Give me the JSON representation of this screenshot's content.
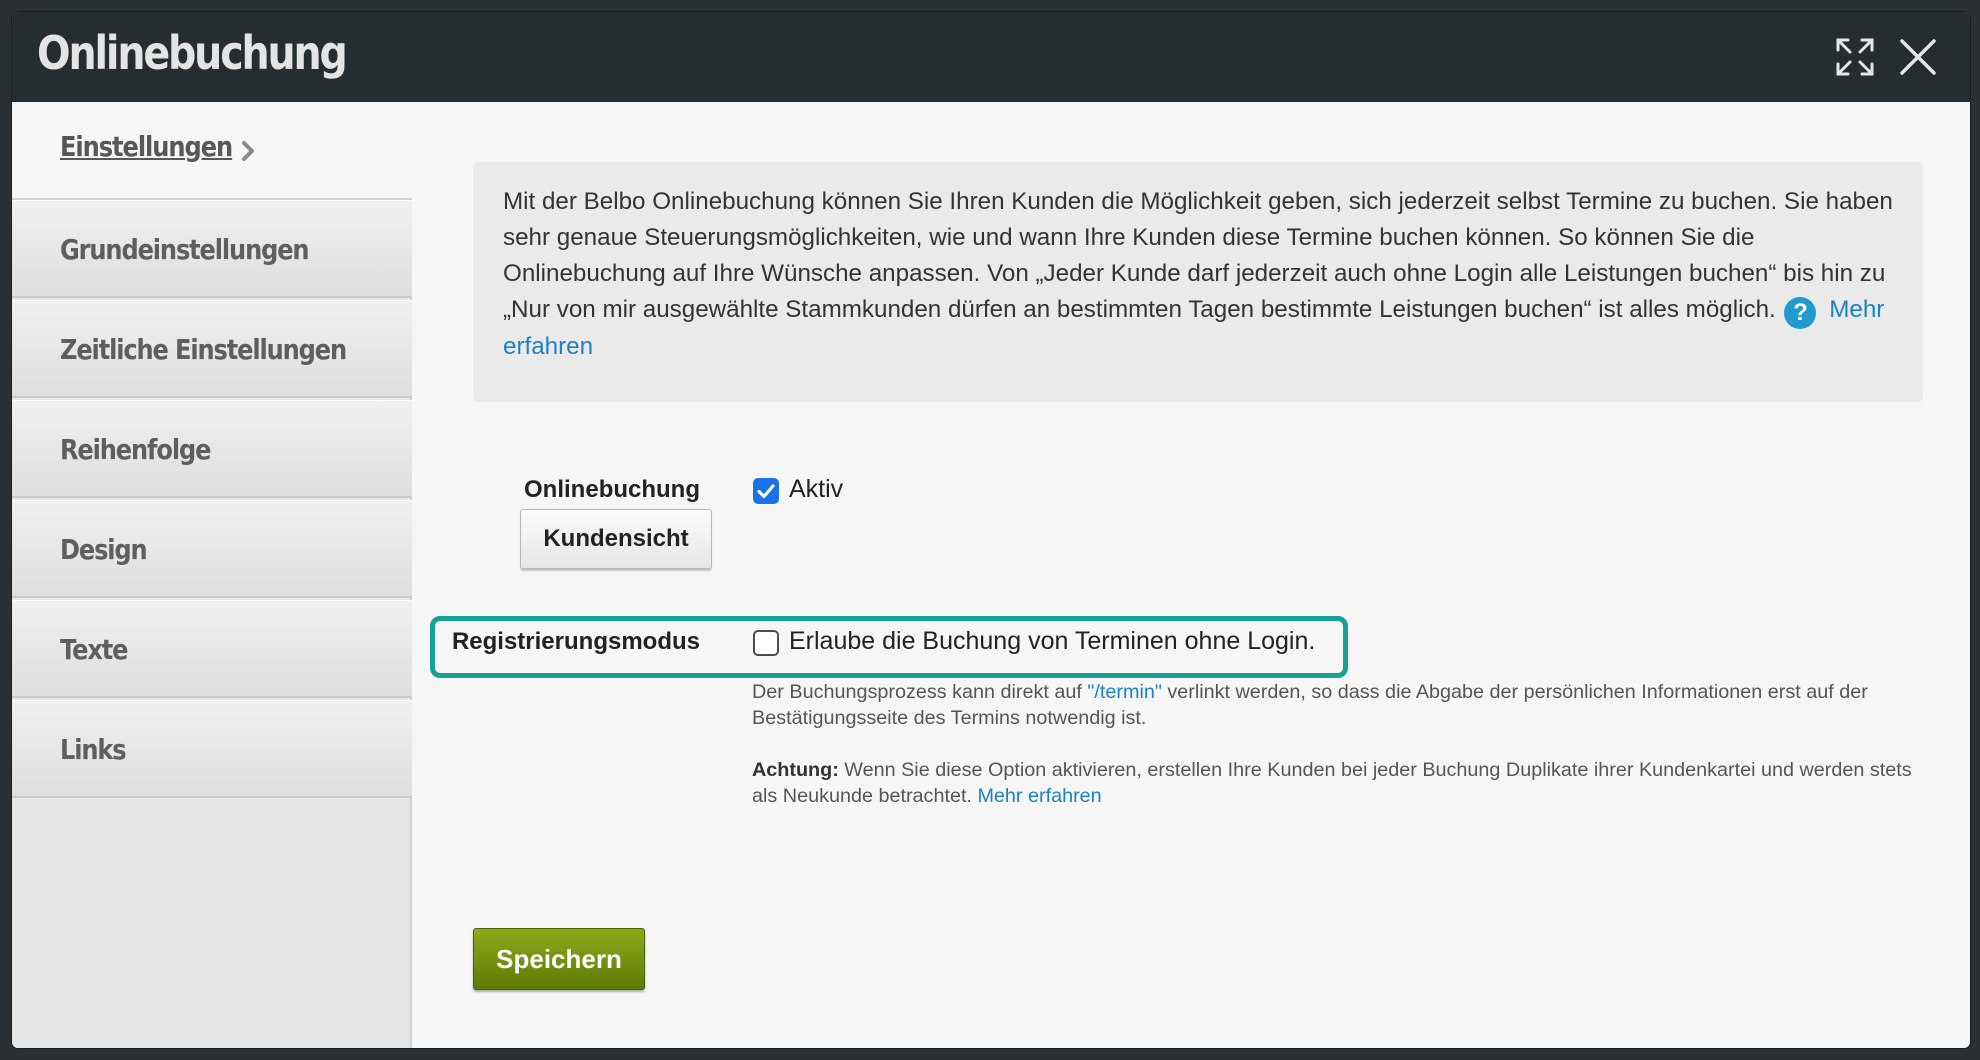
{
  "window": {
    "title": "Onlinebuchung"
  },
  "sidebar": {
    "active": {
      "label": "Einstellungen"
    },
    "items": [
      {
        "label": "Grundeinstellungen"
      },
      {
        "label": "Zeitliche Einstellungen"
      },
      {
        "label": "Reihenfolge"
      },
      {
        "label": "Design"
      },
      {
        "label": "Texte"
      },
      {
        "label": "Links"
      }
    ]
  },
  "info": {
    "text": "Mit der Belbo Onlinebuchung können Sie Ihren Kunden die Möglichkeit geben, sich jederzeit selbst Termine zu buchen. Sie haben sehr genaue Steuerungsmöglichkeiten, wie und wann Ihre Kunden diese Termine buchen können. So können Sie die Onlinebuchung auf Ihre Wünsche anpassen. Von „Jeder Kunde darf jederzeit auch ohne Login alle Leistungen buchen“ bis hin zu „Nur von mir ausgewählte Stammkunden dürfen an bestimmten Tagen bestimmte Leistungen buchen“ ist alles möglich.",
    "help_glyph": "?",
    "link": "Mehr erfahren"
  },
  "form": {
    "onlinebuchung": {
      "label": "Onlinebuchung",
      "checkbox_label": "Aktiv",
      "checked": true,
      "button": "Kundensicht"
    },
    "registrierung": {
      "label": "Registrierungsmodus",
      "checkbox_label": "Erlaube die Buchung von Terminen ohne Login.",
      "checked": false,
      "hint_before": "Der Buchungsprozess kann direkt auf ",
      "hint_link": "\"/termin\"",
      "hint_after": " verlinkt werden, so dass die Abgabe der persönlichen Informationen erst auf der Bestätigungsseite des Termins notwendig ist.",
      "warning_label": "Achtung:",
      "warning_text": " Wenn Sie diese Option aktivieren, erstellen Ihre Kunden bei jeder Buchung Duplikate ihrer Kundenkartei und werden stets als Neukunde betrachtet. ",
      "warning_link": "Mehr erfahren"
    }
  },
  "actions": {
    "save": "Speichern"
  },
  "colors": {
    "titlebar": "#262d31",
    "highlight": "#17a294",
    "link": "#1a82c4",
    "save_button": "#6f8a0e",
    "checkbox_checked": "#1a73e8"
  }
}
